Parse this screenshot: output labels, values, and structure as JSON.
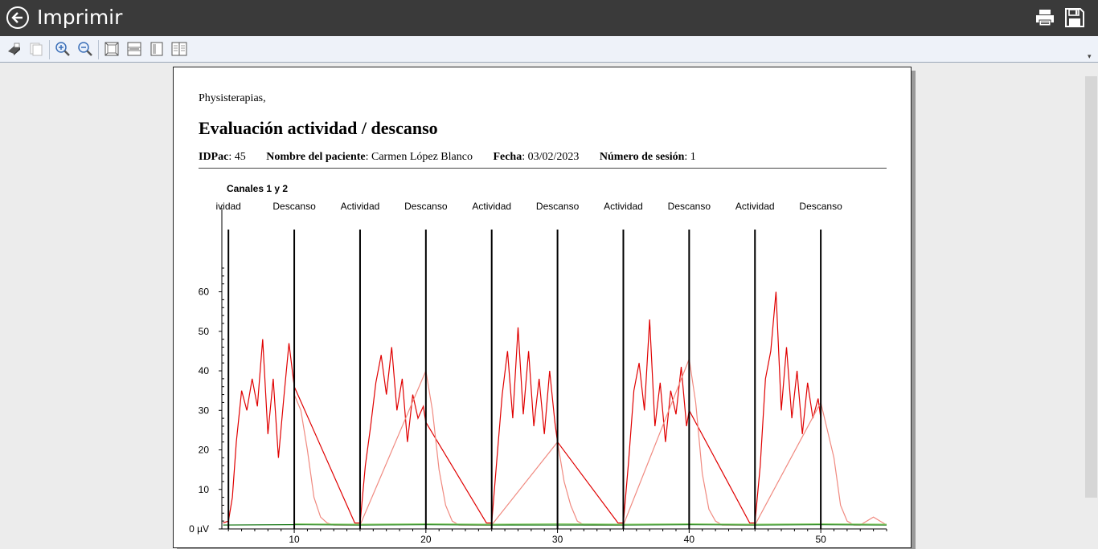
{
  "window": {
    "title": "Imprimir"
  },
  "titlebar_icons": {
    "back": "back-arrow-icon",
    "print": "printer-icon",
    "save": "save-icon"
  },
  "toolbar": {
    "tools": [
      "print-icon",
      "copy-icon",
      "zoom-in-icon",
      "zoom-out-icon",
      "fit-page-icon",
      "page-width-icon",
      "one-page-icon",
      "two-pages-icon"
    ]
  },
  "report": {
    "clinic": "Physisterapias,",
    "title": "Evaluación actividad / descanso",
    "meta": {
      "idpac_label": "IDPac",
      "idpac_value": ": 45",
      "patient_label": "Nombre del paciente",
      "patient_value": ": Carmen López Blanco",
      "date_label": "Fecha",
      "date_value": ": 03/02/2023",
      "session_label": "Número de sesión",
      "session_value": ": 1"
    }
  },
  "chart_data": {
    "type": "line",
    "title": "Canales 1 y 2",
    "y_unit_label": "0 µV",
    "ylim": [
      0,
      66
    ],
    "xlim": [
      4.5,
      55
    ],
    "y_ticks": [
      0,
      10,
      20,
      30,
      40,
      50,
      60
    ],
    "x_ticks": [
      10,
      20,
      30,
      40,
      50
    ],
    "phase_markers": [
      {
        "x": 5,
        "label": "ividad"
      },
      {
        "x": 10,
        "label": "Descanso"
      },
      {
        "x": 15,
        "label": "Actividad"
      },
      {
        "x": 20,
        "label": "Descanso"
      },
      {
        "x": 25,
        "label": "Actividad"
      },
      {
        "x": 30,
        "label": "Descanso"
      },
      {
        "x": 35,
        "label": "Actividad"
      },
      {
        "x": 40,
        "label": "Descanso"
      },
      {
        "x": 45,
        "label": "Actividad"
      },
      {
        "x": 50,
        "label": "Descanso"
      }
    ],
    "series": [
      {
        "color": "#e00000",
        "x": [
          4.6,
          5,
          5.3,
          5.6,
          6,
          6.4,
          6.8,
          7.2,
          7.6,
          8,
          8.4,
          8.8,
          9.2,
          9.6,
          10,
          14.6,
          15,
          15.4,
          15.8,
          16.2,
          16.6,
          17,
          17.4,
          17.8,
          18.2,
          18.6,
          19,
          19.4,
          19.8,
          20,
          24.6,
          25,
          25.4,
          25.8,
          26.2,
          26.6,
          27,
          27.4,
          27.8,
          28.2,
          28.6,
          29,
          29.4,
          29.8,
          30,
          34.6,
          35,
          35.4,
          35.8,
          36.2,
          36.6,
          37,
          37.4,
          37.8,
          38.2,
          38.6,
          39,
          39.4,
          39.8,
          40,
          44.6,
          45,
          45.4,
          45.8,
          46.2,
          46.6,
          47,
          47.4,
          47.8,
          48.2,
          48.6,
          49,
          49.4,
          49.8,
          50
        ],
        "y": [
          1.5,
          2,
          8,
          22,
          35,
          30,
          38,
          31,
          48,
          24,
          38,
          18,
          33,
          47,
          36,
          1.5,
          1.5,
          16,
          26,
          37,
          44,
          34,
          46,
          30,
          38,
          22,
          34,
          28,
          31,
          27,
          1.5,
          1.5,
          18,
          34,
          45,
          28,
          51,
          29,
          45,
          26,
          38,
          24,
          40,
          27,
          22,
          1.5,
          1.5,
          17,
          35,
          42,
          30,
          53,
          26,
          37,
          22,
          35,
          29,
          41,
          26,
          30,
          1.5,
          1.5,
          16,
          38,
          45,
          60,
          30,
          46,
          28,
          40,
          24,
          37,
          28,
          33,
          28
        ]
      },
      {
        "color": "#f08a80",
        "x": [
          10,
          10.5,
          11,
          11.5,
          12,
          12.5,
          13,
          14,
          15,
          20,
          20.5,
          21,
          21.5,
          22,
          22.5,
          23,
          24,
          25,
          30,
          30.5,
          31,
          31.5,
          32,
          32.5,
          33,
          34,
          35,
          40,
          40.5,
          41,
          41.5,
          42,
          42.5,
          43,
          44,
          45,
          50,
          50.5,
          51,
          51.5,
          52,
          52.5,
          53,
          54,
          55
        ],
        "y": [
          34,
          30,
          20,
          8,
          3,
          1.5,
          1,
          1,
          1,
          40,
          30,
          15,
          6,
          2,
          1,
          1,
          1,
          1,
          22,
          12,
          6,
          2,
          1,
          1,
          1,
          1,
          1,
          43,
          32,
          14,
          5,
          2,
          1,
          1,
          1,
          1,
          32,
          25,
          18,
          6,
          2,
          1,
          1,
          3,
          1
        ]
      },
      {
        "color": "#1a7a1a",
        "x": [
          4.6,
          10,
          15,
          20,
          25,
          30,
          35,
          40,
          45,
          50,
          55
        ],
        "y": [
          1,
          1.1,
          1,
          1.1,
          1,
          1,
          1,
          1.1,
          1,
          1.1,
          1
        ]
      },
      {
        "color": "#8fcf6f",
        "x": [
          10,
          15,
          20,
          25,
          30,
          35,
          40,
          45,
          50,
          55
        ],
        "y": [
          1.3,
          1.2,
          1.3,
          1.2,
          1.3,
          1.2,
          1.3,
          1.2,
          1.3,
          1.2
        ]
      }
    ]
  }
}
